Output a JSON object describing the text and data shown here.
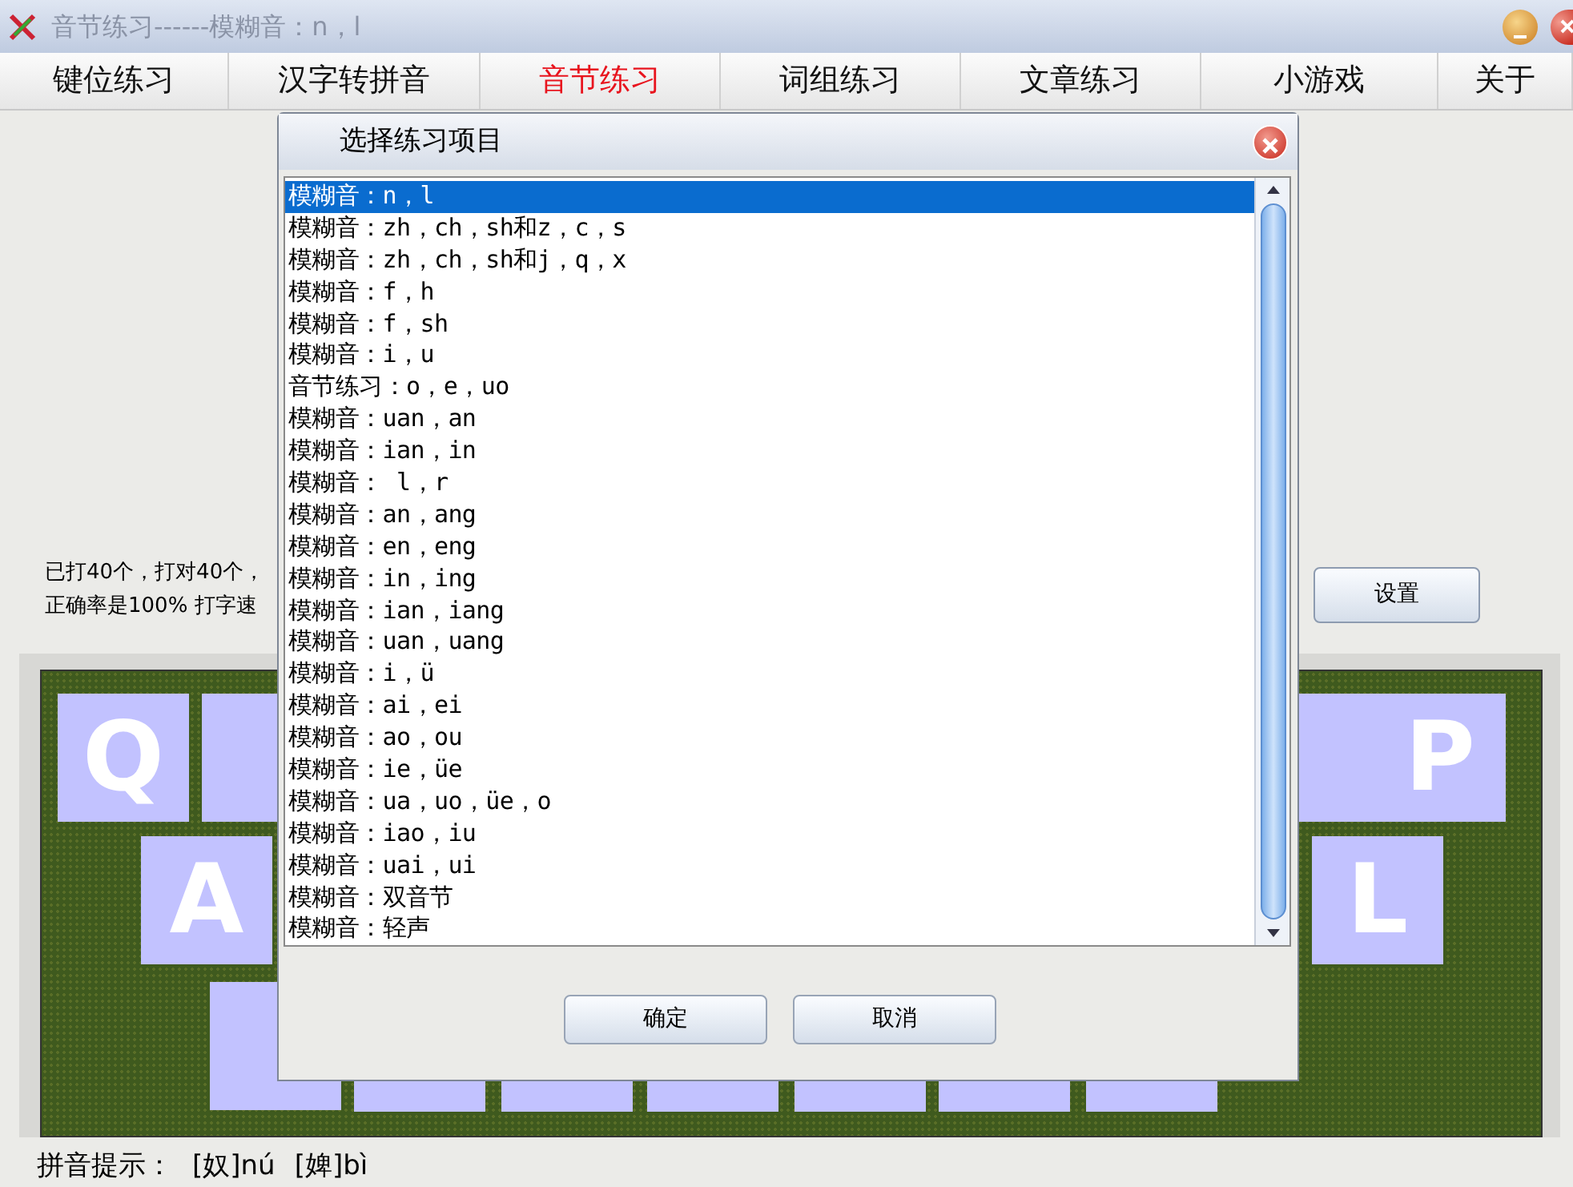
{
  "window": {
    "title": "音节练习------模糊音：n，l"
  },
  "tabs": [
    {
      "label": "键位练习",
      "selected": false
    },
    {
      "label": "汉字转拼音",
      "selected": false
    },
    {
      "label": "音节练习",
      "selected": true
    },
    {
      "label": "词组练习",
      "selected": false
    },
    {
      "label": "文章练习",
      "selected": false
    },
    {
      "label": "小游戏",
      "selected": false
    },
    {
      "label": "关于",
      "selected": false
    }
  ],
  "stats": [
    "已打40个，打对40个，",
    "正确率是100% 打字速"
  ],
  "settings_button": "设置",
  "keyboard": {
    "rows": [
      [
        {
          "kind": "letter",
          "label": "Q"
        },
        {
          "kind": "blank"
        },
        {
          "kind": "blank"
        },
        {
          "kind": "letter",
          "label": "P"
        }
      ],
      [
        {
          "kind": "letter",
          "label": "A"
        },
        {
          "kind": "letter",
          "label": "L"
        }
      ],
      [
        {
          "kind": "blank"
        },
        {
          "kind": "blank"
        },
        {
          "kind": "blank"
        },
        {
          "kind": "blank"
        },
        {
          "kind": "blank"
        },
        {
          "kind": "blank"
        },
        {
          "kind": "blank"
        }
      ]
    ]
  },
  "hint": {
    "label": "拼音提示：",
    "items": [
      "[奴]nú",
      "[婢]bì"
    ]
  },
  "dialog": {
    "title": "选择练习项目",
    "items": [
      {
        "text": "模糊音：n，l",
        "selected": true
      },
      {
        "text": "模糊音：zh，ch，sh和z，c，s",
        "selected": false
      },
      {
        "text": "模糊音：zh，ch，sh和j，q，x",
        "selected": false
      },
      {
        "text": "模糊音：f，h",
        "selected": false
      },
      {
        "text": "模糊音：f，sh",
        "selected": false
      },
      {
        "text": "模糊音：i，u",
        "selected": false
      },
      {
        "text": "音节练习：o，e，uo",
        "selected": false
      },
      {
        "text": "模糊音：uan，an",
        "selected": false
      },
      {
        "text": "模糊音：ian，in",
        "selected": false
      },
      {
        "text": "模糊音： l，r",
        "selected": false
      },
      {
        "text": "模糊音：an，ang",
        "selected": false
      },
      {
        "text": "模糊音：en，eng",
        "selected": false
      },
      {
        "text": "模糊音：in，ing",
        "selected": false
      },
      {
        "text": "模糊音：ian，iang",
        "selected": false
      },
      {
        "text": "模糊音：uan，uang",
        "selected": false
      },
      {
        "text": "模糊音：i，ü",
        "selected": false
      },
      {
        "text": "模糊音：ai，ei",
        "selected": false
      },
      {
        "text": "模糊音：ao，ou",
        "selected": false
      },
      {
        "text": "模糊音：ie，üe",
        "selected": false
      },
      {
        "text": "模糊音：ua，uo，üe，o",
        "selected": false
      },
      {
        "text": "模糊音：iao，iu",
        "selected": false
      },
      {
        "text": "模糊音：uai，ui",
        "selected": false
      },
      {
        "text": "模糊音：双音节",
        "selected": false
      },
      {
        "text": "模糊音：轻声",
        "selected": false
      }
    ],
    "buttons": [
      "确定",
      "取消"
    ]
  }
}
